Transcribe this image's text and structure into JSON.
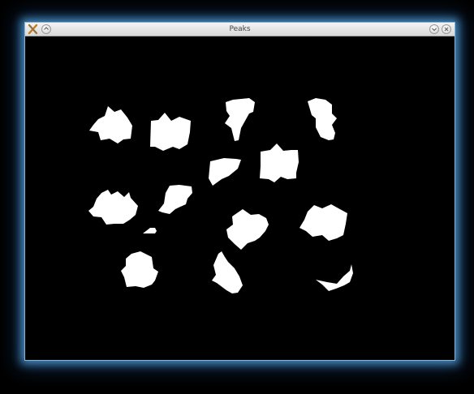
{
  "window": {
    "title": "Peaks"
  },
  "titlebar_icons": {
    "menu": "x-logo-icon",
    "sticky": "pin-icon",
    "minimize": "minimize-icon",
    "close": "close-icon"
  },
  "colors": {
    "glow": "#5aaae6",
    "titlebar": "#e6e6e6",
    "canvas_background": "#000000",
    "blob_fill": "#ffffff"
  }
}
